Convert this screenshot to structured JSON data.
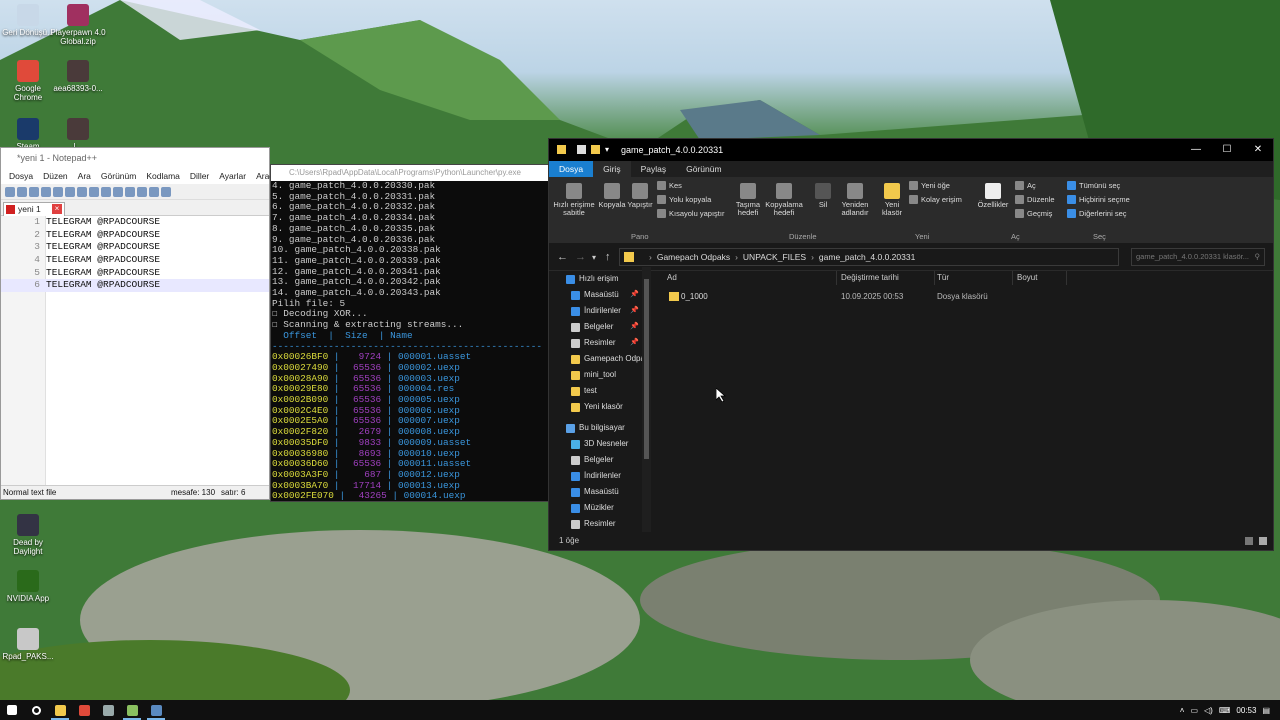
{
  "desktop": {
    "icons": [
      {
        "label": "Geri Dönüşü...",
        "icon": "recycle-bin-icon",
        "color": "#c8d8e8"
      },
      {
        "label": "Playerpawn 4.0 Global.zip",
        "icon": "winrar-icon",
        "color": "#a03060"
      },
      {
        "label": "Google Chrome",
        "icon": "chrome-icon",
        "color": "#e04a3a"
      },
      {
        "label": "aea68393-0...",
        "icon": "image-file-icon",
        "color": "#4a3a3a"
      },
      {
        "label": "Steam",
        "icon": "steam-icon",
        "color": "#1a3a6a"
      },
      {
        "label": "l...",
        "icon": "image-file-icon",
        "color": "#4a3a3a"
      },
      {
        "label": "Dead by Daylight",
        "icon": "game-icon",
        "color": "#334"
      },
      {
        "label": "NVIDIA App",
        "icon": "nvidia-icon",
        "color": "#2a6a1a"
      },
      {
        "label": "Rpad_PAKS...",
        "icon": "file-icon",
        "color": "#c8c8c8"
      }
    ]
  },
  "notepad": {
    "title": "*yeni 1 - Notepad++",
    "menu": [
      "Dosya",
      "Düzen",
      "Ara",
      "Görünüm",
      "Kodlama",
      "Diller",
      "Ayarlar",
      "Araçlar"
    ],
    "tab_label": "yeni 1",
    "lines": [
      {
        "n": "1",
        "text": "TELEGRAM @RPADCOURSE"
      },
      {
        "n": "2",
        "text": "TELEGRAM @RPADCOURSE"
      },
      {
        "n": "3",
        "text": "TELEGRAM @RPADCOURSE"
      },
      {
        "n": "4",
        "text": "TELEGRAM @RPADCOURSE"
      },
      {
        "n": "5",
        "text": "TELEGRAM @RPADCOURSE"
      },
      {
        "n": "6",
        "text": "TELEGRAM @RPADCOURSE"
      }
    ],
    "status_type": "Normal text file",
    "status_length": "mesafe: 130",
    "status_lines": "satır: 6"
  },
  "terminal": {
    "title": "C:\\Users\\Rpad\\AppData\\Local\\Programs\\Python\\Launcher\\py.exe",
    "list_lines": [
      "4. game_patch_4.0.0.20330.pak",
      "5. game_patch_4.0.0.20331.pak",
      "6. game_patch_4.0.0.20332.pak",
      "7. game_patch_4.0.0.20334.pak",
      "8. game_patch_4.0.0.20335.pak",
      "9. game_patch_4.0.0.20336.pak",
      "10. game_patch_4.0.0.20338.pak",
      "11. game_patch_4.0.0.20339.pak",
      "12. game_patch_4.0.0.20341.pak",
      "13. game_patch_4.0.0.20342.pak",
      "14. game_patch_4.0.0.20343.pak",
      "Pilih file: 5",
      "☐ Decoding XOR...",
      "☐ Scanning & extracting streams..."
    ],
    "table_header": "  Offset  |  Size  | Name",
    "separator": "------------------------------------------------",
    "rows": [
      {
        "offset": "0x00026BF0",
        "size": "9724",
        "name": "000001.uasset"
      },
      {
        "offset": "0x00027490",
        "size": "65536",
        "name": "000002.uexp"
      },
      {
        "offset": "0x00028A90",
        "size": "65536",
        "name": "000003.uexp"
      },
      {
        "offset": "0x00029E80",
        "size": "65536",
        "name": "000004.res"
      },
      {
        "offset": "0x0002B090",
        "size": "65536",
        "name": "000005.uexp"
      },
      {
        "offset": "0x0002C4E0",
        "size": "65536",
        "name": "000006.uexp"
      },
      {
        "offset": "0x0002E5A0",
        "size": "65536",
        "name": "000007.uexp"
      },
      {
        "offset": "0x0002F820",
        "size": "2679",
        "name": "000008.uexp"
      },
      {
        "offset": "0x00035DF0",
        "size": "9833",
        "name": "000009.uasset"
      },
      {
        "offset": "0x00036980",
        "size": "8693",
        "name": "000010.uexp"
      },
      {
        "offset": "0x00036D60",
        "size": "65536",
        "name": "000011.uasset"
      },
      {
        "offset": "0x0003A3F0",
        "size": "687",
        "name": "000012.uexp"
      },
      {
        "offset": "0x0003BA70",
        "size": "17714",
        "name": "000013.uexp"
      },
      {
        "offset": "0x0002FE070",
        "size": "43265",
        "name": "000014.uexp"
      }
    ]
  },
  "explorer": {
    "title": "game_patch_4.0.0.20331",
    "ribbon_tabs": [
      "Dosya",
      "Giriş",
      "Paylaş",
      "Görünüm"
    ],
    "ribbon": {
      "pin": "Hızlı erişime sabitle",
      "copy": "Kopyala",
      "paste": "Yapıştır",
      "cut": "Kes",
      "copy_path": "Yolu kopyala",
      "paste_shortcut": "Kısayolu yapıştır",
      "group_clipboard": "Pano",
      "move_to": "Taşıma hedefi",
      "copy_to": "Kopyalama hedefi",
      "delete": "Sil",
      "rename": "Yeniden adlandır",
      "group_organize": "Düzenle",
      "new_folder": "Yeni klasör",
      "new_item": "Yeni öğe",
      "easy_access": "Kolay erişim",
      "group_new": "Yeni",
      "properties": "Özellikler",
      "open": "Aç",
      "edit": "Düzenle",
      "history": "Geçmiş",
      "group_open": "Aç",
      "select_all": "Tümünü seç",
      "select_none": "Hiçbirini seçme",
      "invert": "Diğerlerini seç",
      "group_select": "Seç"
    },
    "breadcrumbs": [
      "Gamepach Odpaks",
      "UNPACK_FILES",
      "game_patch_4.0.0.20331"
    ],
    "search_placeholder": "game_patch_4.0.0.20331 klasör...",
    "nav": [
      {
        "label": "Hızlı erişim",
        "icon": "star-icon",
        "color": "#3a8ee6",
        "sec": true
      },
      {
        "label": "Masaüstü",
        "icon": "desktop-icon",
        "color": "#3a8ee6",
        "pin": true
      },
      {
        "label": "İndirilenler",
        "icon": "download-icon",
        "color": "#3a8ee6",
        "pin": true
      },
      {
        "label": "Belgeler",
        "icon": "documents-icon",
        "color": "#ccc",
        "pin": true
      },
      {
        "label": "Resimler",
        "icon": "pictures-icon",
        "color": "#ccc",
        "pin": true
      },
      {
        "label": "Gamepach Odpa",
        "icon": "folder-icon",
        "color": "#f2c94c"
      },
      {
        "label": "mini_tool",
        "icon": "folder-icon",
        "color": "#f2c94c"
      },
      {
        "label": "test",
        "icon": "folder-icon",
        "color": "#f2c94c"
      },
      {
        "label": "Yeni klasör",
        "icon": "folder-icon",
        "color": "#f2c94c"
      },
      {
        "label": "Bu bilgisayar",
        "icon": "computer-icon",
        "color": "#5aa0e6",
        "sec": true
      },
      {
        "label": "3D Nesneler",
        "icon": "3d-objects-icon",
        "color": "#4ab0e6"
      },
      {
        "label": "Belgeler",
        "icon": "documents-icon",
        "color": "#ccc"
      },
      {
        "label": "İndirilenler",
        "icon": "download-icon",
        "color": "#3a8ee6"
      },
      {
        "label": "Masaüstü",
        "icon": "desktop-icon",
        "color": "#3a8ee6"
      },
      {
        "label": "Müzikler",
        "icon": "music-icon",
        "color": "#3a8ee6"
      },
      {
        "label": "Resimler",
        "icon": "pictures-icon",
        "color": "#ccc"
      }
    ],
    "columns": {
      "name": "Ad",
      "date": "Değiştirme tarihi",
      "type": "Tür",
      "size": "Boyut"
    },
    "files": [
      {
        "name": "0_1000",
        "date": "10.09.2025 00:53",
        "type": "Dosya klasörü",
        "size": ""
      }
    ],
    "status": "1 öğe"
  },
  "taskbar": {
    "clock": "00:53",
    "apps": [
      {
        "icon": "start-icon",
        "color": "#ffffff",
        "active": false
      },
      {
        "icon": "search-icon",
        "color": "#ffffff",
        "active": false
      },
      {
        "icon": "explorer-icon",
        "color": "#f2c94c",
        "active": true
      },
      {
        "icon": "chrome-icon",
        "color": "#e04a3a",
        "active": false
      },
      {
        "icon": "steam-icon",
        "color": "#9aa",
        "active": false
      },
      {
        "icon": "notepadpp-icon",
        "color": "#8ac060",
        "active": true
      },
      {
        "icon": "python-icon",
        "color": "#5a8ac0",
        "active": true
      }
    ]
  }
}
